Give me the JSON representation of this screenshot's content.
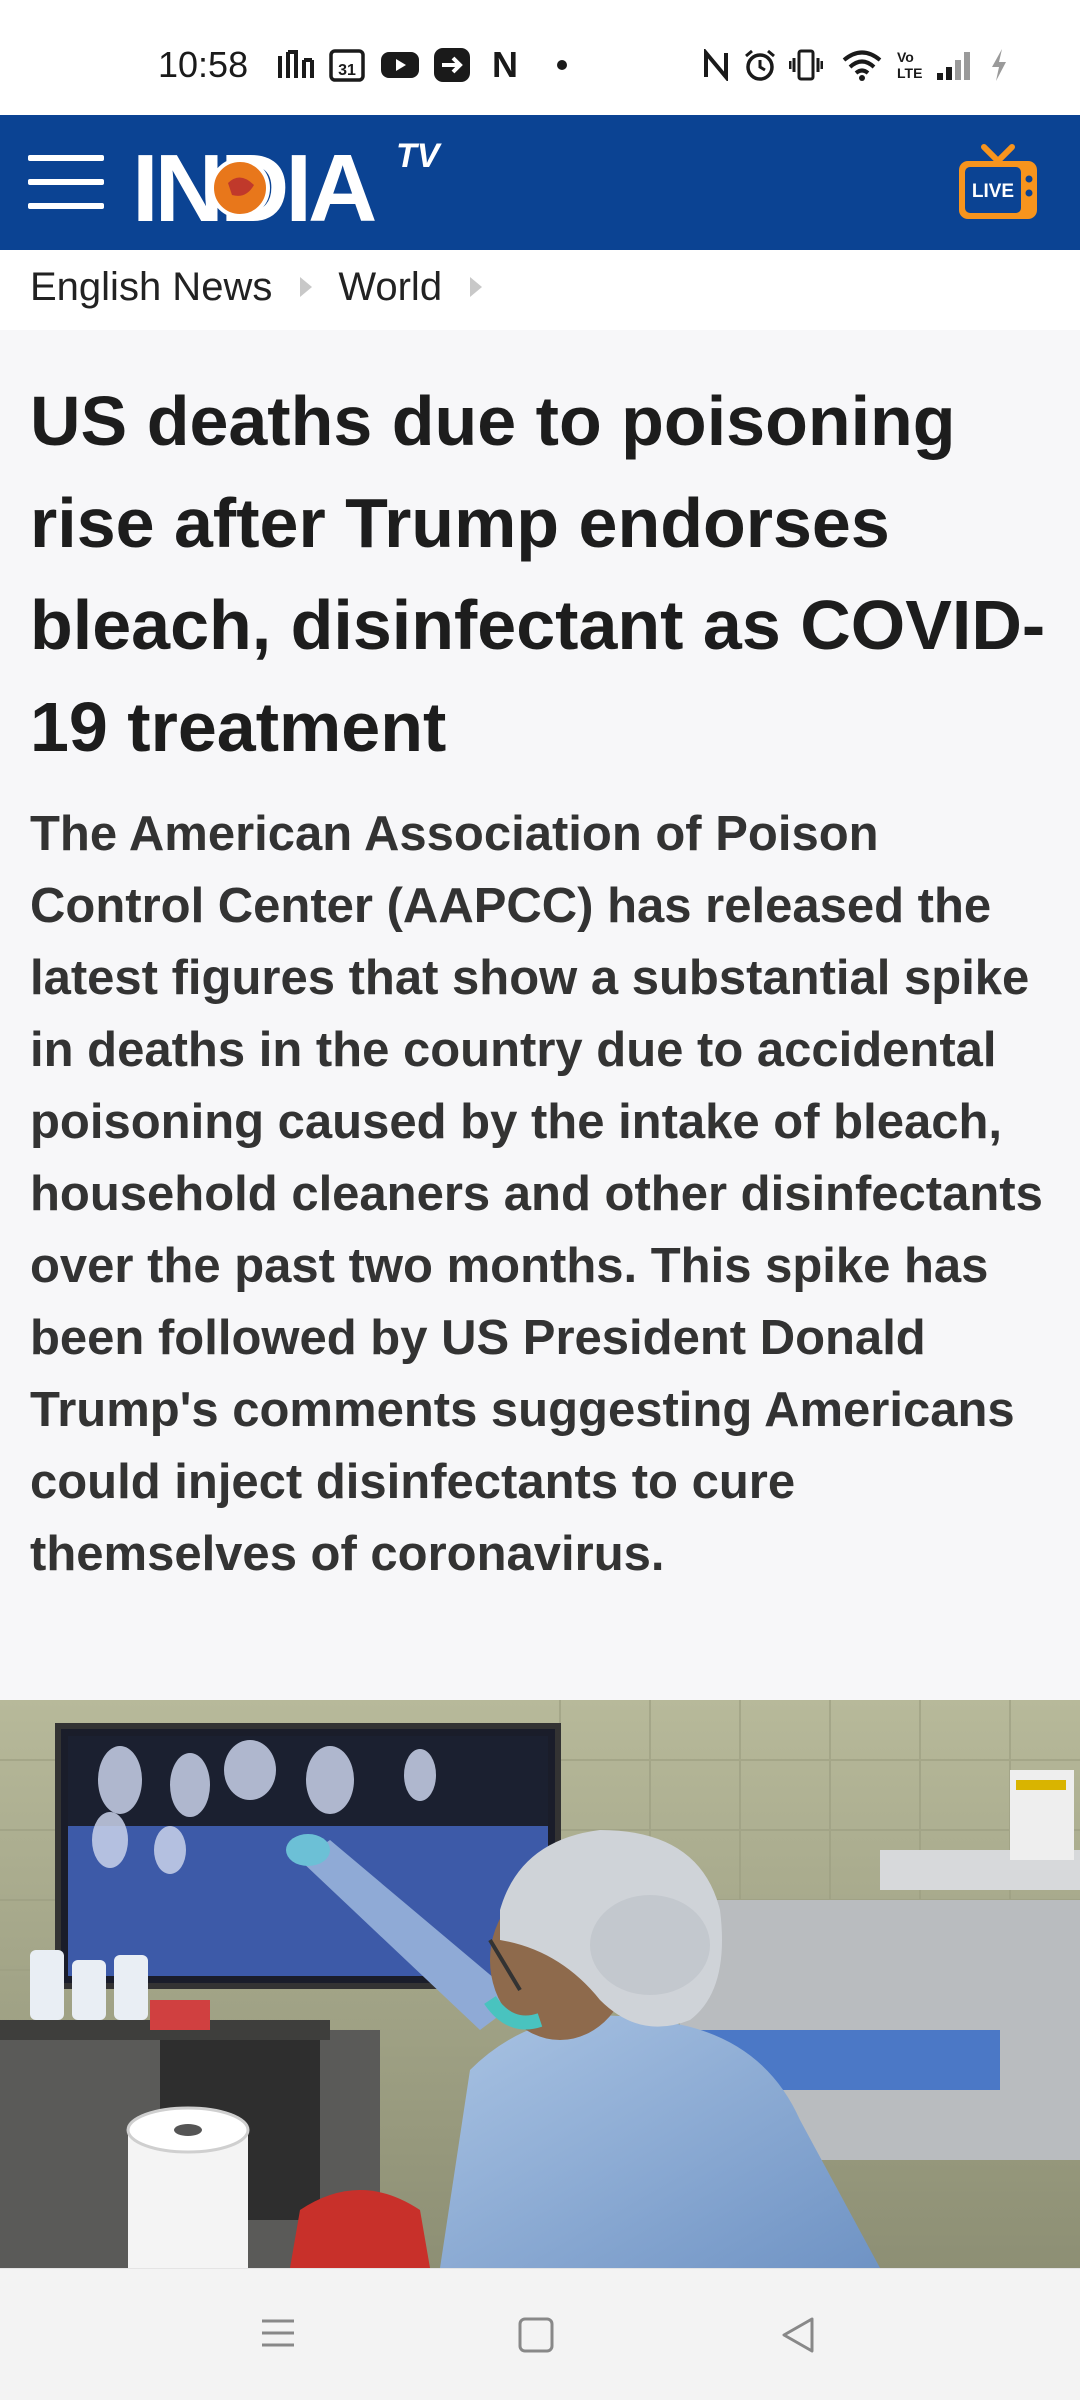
{
  "status_bar": {
    "time": "10:58",
    "left_icons": [
      "signal-app-icon",
      "calendar-31-icon",
      "youtube-icon",
      "share-arrow-icon",
      "netflix-n-icon",
      "dot-icon"
    ],
    "calendar_day": "31",
    "netflix_letter": "N",
    "right_icons": [
      "nfc-icon",
      "alarm-icon",
      "vibrate-icon",
      "wifi-icon",
      "volte-icon",
      "cell-signal-icon",
      "battery-charging-icon"
    ]
  },
  "header": {
    "logo_main": "INDIA",
    "logo_sup": "TV",
    "live_label": "LIVE",
    "accent": "#0b4393",
    "live_color": "#f7941d"
  },
  "breadcrumb": {
    "items": [
      "English News",
      "World"
    ]
  },
  "article": {
    "headline": "US deaths due to poisoning rise after Trump endorses bleach, disinfectant as COVID-19 treatment",
    "summary": "The American Association of Poison Control Center (AAPCC) has released the latest figures that show a substantial spike in deaths in the country due to accidental poisoning caused by the intake of bleach, household cleaners and other disinfectants over the past two months. This spike has been followed by US President Donald Trump's comments suggesting Americans could inject disinfectants to cure themselves of coronavirus."
  },
  "nav_bar": {
    "buttons": [
      "menu-icon",
      "home-square-icon",
      "back-triangle-icon"
    ]
  }
}
